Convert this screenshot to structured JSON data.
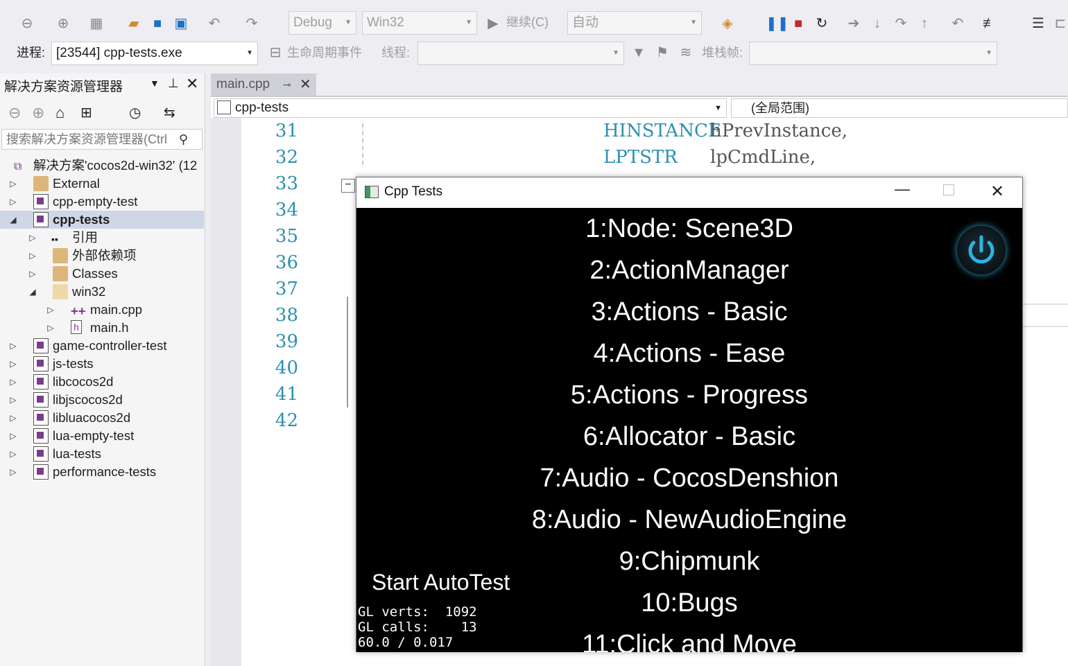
{
  "toolbar": {
    "config": "Debug",
    "platform": "Win32",
    "continue_label": "继续(C)",
    "auto_combo": "自动"
  },
  "debug_location": {
    "process_label": "进程:",
    "process_value": "[23544] cpp-tests.exe",
    "lifecycle_label": "生命周期事件",
    "thread_label": "线程:",
    "stackframe_label": "堆栈帧:"
  },
  "solution_explorer": {
    "title": "解决方案资源管理器",
    "search_placeholder": "搜索解决方案资源管理器(Ctrl",
    "items": [
      {
        "label": "解决方案'cocos2d-win32' (12"
      },
      {
        "label": "External"
      },
      {
        "label": "cpp-empty-test"
      },
      {
        "label": "cpp-tests"
      },
      {
        "label": "引用"
      },
      {
        "label": "外部依赖项"
      },
      {
        "label": "Classes"
      },
      {
        "label": "win32"
      },
      {
        "label": "main.cpp"
      },
      {
        "label": "main.h"
      },
      {
        "label": "game-controller-test"
      },
      {
        "label": "js-tests"
      },
      {
        "label": "libcocos2d"
      },
      {
        "label": "libjscocos2d"
      },
      {
        "label": "libluacocos2d"
      },
      {
        "label": "lua-empty-test"
      },
      {
        "label": "lua-tests"
      },
      {
        "label": "performance-tests"
      }
    ]
  },
  "editor": {
    "tab_label": "main.cpp",
    "nav_project": "cpp-tests",
    "nav_scope": "(全局范围)",
    "line_numbers": [
      "31",
      "32",
      "33",
      "34",
      "35",
      "36",
      "37",
      "38",
      "39",
      "40",
      "41",
      "42"
    ],
    "code_line_31_type": "HINSTANCE",
    "code_line_31_name": "hPrevInstance,",
    "code_line_32_type": "LPTSTR",
    "code_line_32_name": "lpCmdLine,"
  },
  "app_window": {
    "title": "Cpp Tests",
    "menu_items": [
      "1:Node: Scene3D",
      "2:ActionManager",
      "3:Actions - Basic",
      "4:Actions - Ease",
      "5:Actions - Progress",
      "6:Allocator - Basic",
      "7:Audio - CocosDenshion",
      "8:Audio - NewAudioEngine",
      "9:Chipmunk",
      "10:Bugs",
      "11:Click and Move"
    ],
    "autotest_label": "Start AutoTest",
    "stats": [
      "GL verts:  1092",
      "GL calls:    13",
      "60.0 / 0.017"
    ]
  },
  "colors": {
    "accent_blue": "#1e6fc8",
    "stop_red": "#c62828",
    "line_number": "#2b91af",
    "project_purple": "#7a3c8c"
  }
}
